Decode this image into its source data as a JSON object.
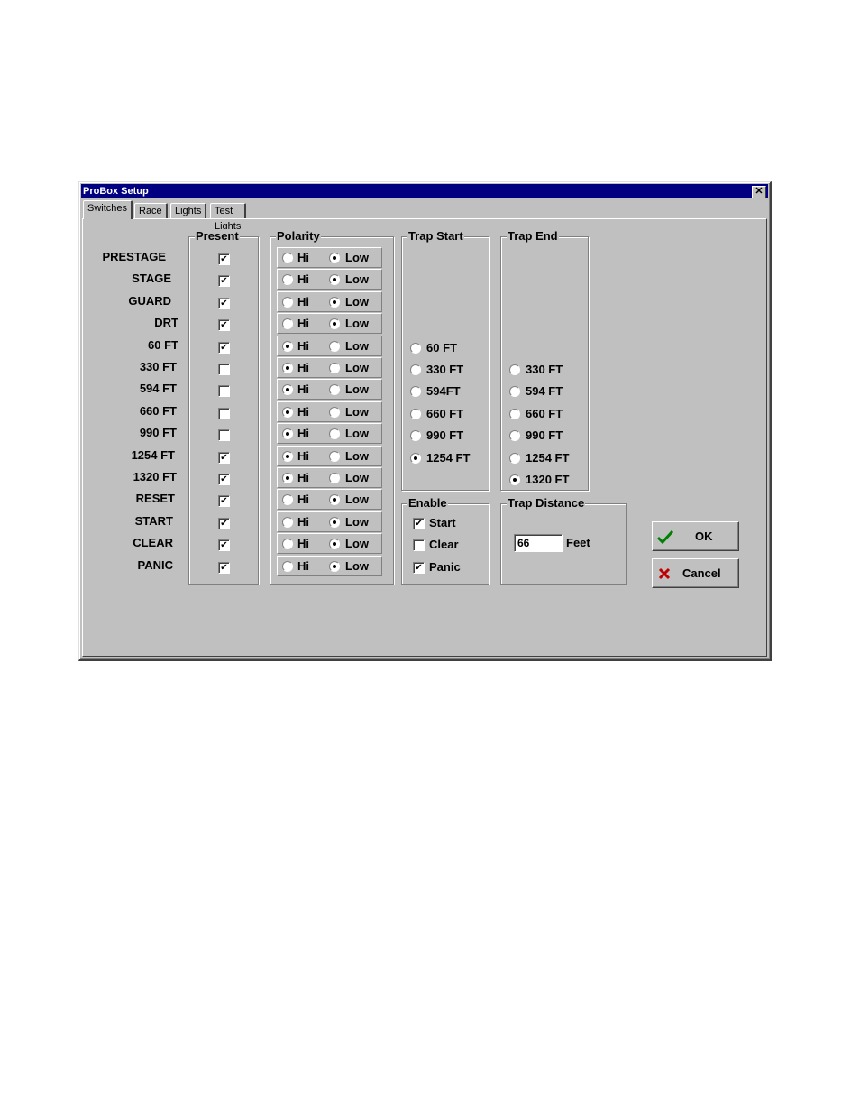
{
  "window": {
    "title": "ProBox Setup",
    "close_symbol": "✕"
  },
  "tabs": [
    {
      "label": "Switches",
      "active": true
    },
    {
      "label": "Race",
      "active": false
    },
    {
      "label": "Lights",
      "active": false
    },
    {
      "label": "Test Lights",
      "active": false
    }
  ],
  "groups": {
    "present": "Present",
    "polarity": "Polarity",
    "trap_start": "Trap Start",
    "trap_end": "Trap End",
    "enable": "Enable",
    "trap_distance": "Trap Distance"
  },
  "switches": [
    {
      "name": "PRESTAGE",
      "present": true,
      "polarity": "Low"
    },
    {
      "name": "STAGE",
      "present": true,
      "polarity": "Low"
    },
    {
      "name": "GUARD",
      "present": true,
      "polarity": "Low"
    },
    {
      "name": "DRT",
      "present": true,
      "polarity": "Low"
    },
    {
      "name": "60 FT",
      "present": true,
      "polarity": "Hi"
    },
    {
      "name": "330 FT",
      "present": false,
      "polarity": "Hi"
    },
    {
      "name": "594 FT",
      "present": false,
      "polarity": "Hi"
    },
    {
      "name": "660 FT",
      "present": false,
      "polarity": "Hi"
    },
    {
      "name": "990 FT",
      "present": false,
      "polarity": "Hi"
    },
    {
      "name": "1254 FT",
      "present": true,
      "polarity": "Hi"
    },
    {
      "name": "1320 FT",
      "present": true,
      "polarity": "Hi"
    },
    {
      "name": "RESET",
      "present": true,
      "polarity": "Low"
    },
    {
      "name": "START",
      "present": true,
      "polarity": "Low"
    },
    {
      "name": "CLEAR",
      "present": true,
      "polarity": "Low"
    },
    {
      "name": "PANIC",
      "present": true,
      "polarity": "Low"
    }
  ],
  "polarity_labels": {
    "hi": "Hi",
    "low": "Low"
  },
  "trap_start": {
    "options": [
      "60 FT",
      "330 FT",
      "594FT",
      "660 FT",
      "990 FT",
      "1254 FT"
    ],
    "selected": "1254 FT"
  },
  "trap_end": {
    "options": [
      "330 FT",
      "594 FT",
      "660 FT",
      "990 FT",
      "1254 FT",
      "1320 FT"
    ],
    "selected": "1320 FT"
  },
  "enable": [
    {
      "label": "Start",
      "checked": true
    },
    {
      "label": "Clear",
      "checked": false
    },
    {
      "label": "Panic",
      "checked": true
    }
  ],
  "trap_distance": {
    "value": "66",
    "unit": "Feet"
  },
  "buttons": {
    "ok": "OK",
    "cancel": "Cancel"
  },
  "colors": {
    "titlebar": "#000080",
    "face": "#c0c0c0",
    "ok_check": "#008000",
    "cancel_x": "#c00000"
  }
}
